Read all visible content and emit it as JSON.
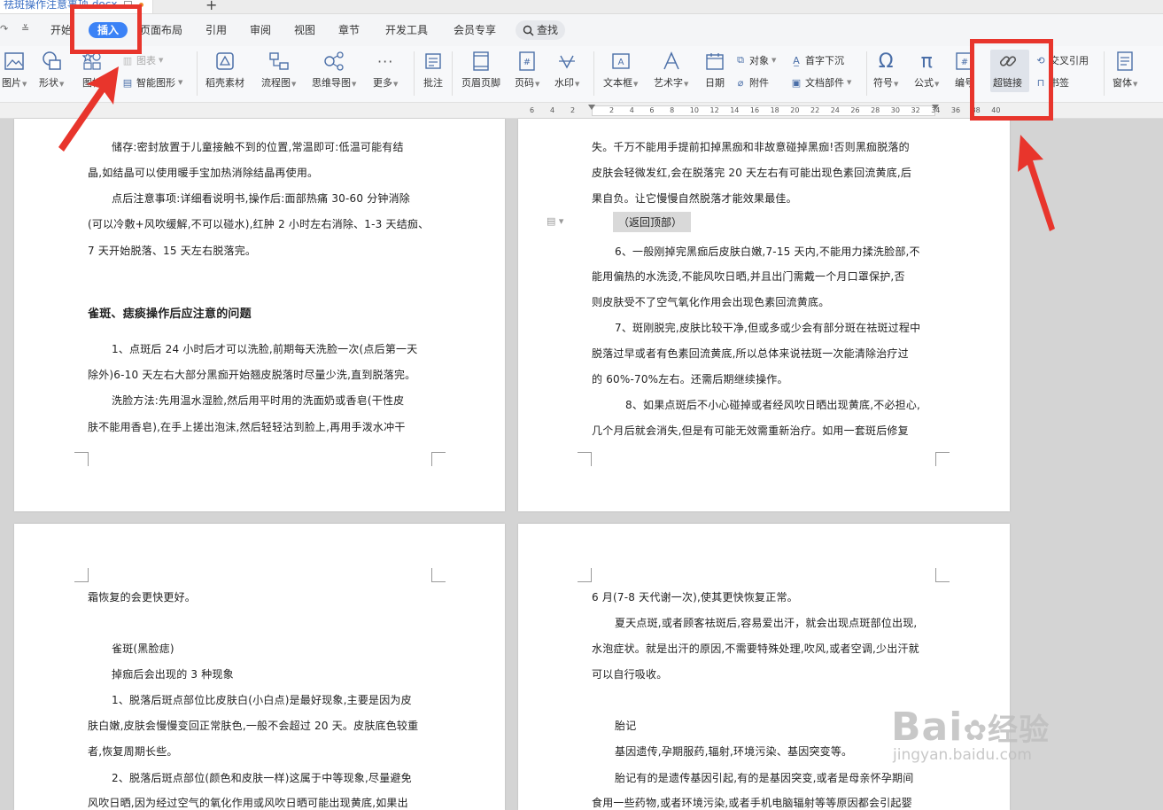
{
  "titlebar": {
    "doc_name": "祛斑操作注意事项.docx",
    "new_tab": "+"
  },
  "menu": {
    "items": [
      "开始",
      "插入",
      "页面布局",
      "引用",
      "审阅",
      "视图",
      "章节",
      "开发工具",
      "会员专享"
    ],
    "active": "插入",
    "search": "查找"
  },
  "ribbon": {
    "picture": "图片",
    "shape": "形状",
    "icon": "图标",
    "chart": "图表",
    "smart_shape": "智能图形",
    "material": "稻壳素材",
    "flowchart": "流程图",
    "mindmap": "思维导图",
    "more": "更多",
    "comment": "批注",
    "header_footer": "页眉页脚",
    "page_number": "页码",
    "watermark": "水印",
    "textbox": "文本框",
    "wordart": "艺术字",
    "date": "日期",
    "object": "对象",
    "attachment": "附件",
    "dropcap": "首字下沉",
    "doc_parts": "文档部件",
    "symbol": "符号",
    "formula": "公式",
    "numbering": "编号",
    "hyperlink": "超链接",
    "cross_ref": "交叉引用",
    "bookmark": "书签",
    "window": "窗体"
  },
  "ruler": {
    "left_ticks": [
      "6",
      "4",
      "2"
    ],
    "ticks": [
      "2",
      "4",
      "6",
      "8",
      "10",
      "12",
      "14",
      "16",
      "18",
      "20",
      "22",
      "24",
      "26",
      "28",
      "30",
      "32",
      "34",
      "36",
      "38",
      "40"
    ]
  },
  "page_tl": {
    "lines": [
      "储存:密封放置于儿童接触不到的位置,常温即可:低温可能有结",
      "晶,如结晶可以使用暖手宝加热消除结晶再使用。",
      "点后注意事项:详细看说明书,操作后:面部热痛 30-60 分钟消除",
      "(可以冷敷+风吹缓解,不可以碰水),红肿 2 小时左右消除、1-3 天结痂、",
      "7 天开始脱落、15 天左右脱落完。",
      "雀斑、痣痰操作后应注意的问题",
      "1、点斑后 24 小时后才可以洗脸,前期每天洗脸一次(点后第一天",
      "除外)6-10 天左右大部分黑痂开始翘皮脱落时尽量少洗,直到脱落完。",
      "洗脸方法:先用温水湿脸,然后用平时用的洗面奶或香皂(干性皮",
      "肤不能用香皂),在手上搓出泡沫,然后轻轻沽到脸上,再用手泼水冲干"
    ]
  },
  "page_tr": {
    "lines": [
      "失。千万不能用手提前扣掉黑痂和非故意碰掉黑痂!否则黑痂脱落的",
      "皮肤会轻微发红,会在脱落完 20 天左右有可能出现色素回流黄底,后",
      "果自负。让它慢慢自然脱落才能效果最佳。",
      "6、一般刚掉完黑痂后皮肤白嫩,7-15 天内,不能用力揉洗脸部,不",
      "能用偏热的水洗烫,不能风吹日晒,并且出门需戴一个月口罩保护,否",
      "则皮肤受不了空气氧化作用会出现色素回流黄底。",
      "7、斑刚脱完,皮肤比较干净,但或多或少会有部分斑在祛斑过程中",
      "脱落过早或者有色素回流黄底,所以总体来说祛斑一次能清除治疗过",
      "的 60%-70%左右。还需后期继续操作。",
      "8、如果点斑后不小心碰掉或者经风吹日晒出现黄底,不必担心,",
      "几个月后就会消失,但是有可能无效需重新治疗。如用一套斑后修复"
    ],
    "back_to_top": "（返回顶部）"
  },
  "page_bl": {
    "lines": [
      "霜恢复的会更快更好。",
      "雀斑(黑脸痣)",
      "掉痂后会出现的 3 种现象",
      "1、脱落后斑点部位比皮肤白(小白点)是最好现象,主要是因为皮",
      "肤白嫩,皮肤会慢慢变回正常肤色,一般不会超过 20 天。皮肤底色较重",
      "者,恢复周期长些。",
      "2、脱落后斑点部位(颜色和皮肤一样)这属于中等现象,尽量避免",
      "风吹日晒,因为经过空气的氧化作用或风吹日晒可能出现黄底,如果出"
    ]
  },
  "page_br": {
    "lines": [
      "6 月(7-8 天代谢一次),使其更快恢复正常。",
      "夏天点斑,或者顾客祛斑后,容易爱出汗，就会出现点斑部位出现,",
      "水泡症状。就是出汗的原因,不需要特殊处理,吹风,或者空调,少出汗就",
      "可以自行吸收。",
      "胎记",
      "基因遗传,孕期服药,辐射,环境污染、基因突变等。",
      "胎记有的是遗传基因引起,有的是基因突变,或者是母亲怀孕期间",
      "食用一些药物,或者环境污染,或者手机电脑辐射等等原因都会引起婴"
    ]
  },
  "watermark": {
    "brand": "Bai",
    "brand2": "经验",
    "url": "jingyan.baidu.com"
  },
  "colors": {
    "accent": "#3b82f6",
    "annotation": "#e8352c",
    "ribbon_icon": "#4b6fa8"
  }
}
